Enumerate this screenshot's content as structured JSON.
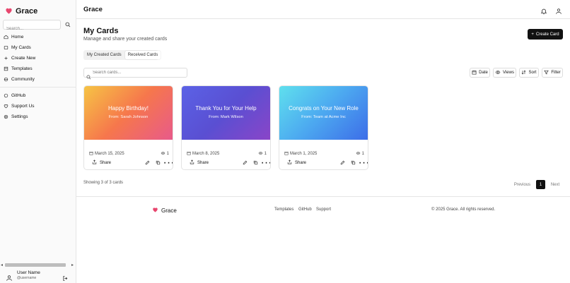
{
  "app": {
    "brand": "Grace"
  },
  "sidebar": {
    "search_placeholder": "Search...",
    "items": [
      {
        "label": "Home",
        "icon": "home-icon"
      },
      {
        "label": "My Cards",
        "icon": "cards-icon"
      },
      {
        "label": "Create New",
        "icon": "plus-icon"
      },
      {
        "label": "Templates",
        "icon": "templates-icon"
      },
      {
        "label": "Community",
        "icon": "community-icon"
      },
      {
        "label": "GitHub",
        "icon": "github-icon"
      },
      {
        "label": "Support Us",
        "icon": "heart-icon"
      },
      {
        "label": "Settings",
        "icon": "gear-icon"
      }
    ],
    "user": {
      "name": "User Name",
      "handle": "@username"
    }
  },
  "header": {
    "title": "Grace"
  },
  "main": {
    "title": "My Cards",
    "subtitle": "Manage and share your created cards",
    "create_label": "Create Card",
    "tabs": [
      {
        "label": "My Created Cards",
        "active": false
      },
      {
        "label": "Received Cards",
        "active": true
      }
    ],
    "search_placeholder": "Search cards...",
    "tools": {
      "date": "Date",
      "views": "Views",
      "sort": "Sort",
      "filter": "Filter"
    },
    "cards": [
      {
        "title": "Happy Birthday!",
        "from": "From: Sarah Johnson",
        "date": "March 15, 2025",
        "views": "1",
        "share": "Share",
        "gradient": [
          "#f6c445",
          "#f6774c",
          "#e85a8a"
        ]
      },
      {
        "title": "Thank You for Your Help",
        "from": "From: Mark Wilson",
        "date": "March 8, 2025",
        "views": "1",
        "share": "Share",
        "gradient": [
          "#5b62e6",
          "#5a4fd2",
          "#8a45c8"
        ]
      },
      {
        "title": "Congrats on Your New Role",
        "from": "From: Team at Acme Inc",
        "date": "March 1, 2025",
        "views": "1",
        "share": "Share",
        "gradient": [
          "#5fe0ee",
          "#4ca8f0",
          "#3d6de8"
        ]
      }
    ],
    "showing": "Showing 3 of 3 cards",
    "pagination": {
      "previous": "Previous",
      "current": "1",
      "next": "Next"
    }
  },
  "footer": {
    "brand": "Grace",
    "links": [
      "Templates",
      "GitHub",
      "Support"
    ],
    "copyright": "© 2025 Grace. All rights reserved."
  },
  "colors": {
    "brand_heart": "#e8466e",
    "primary": "#111111"
  }
}
